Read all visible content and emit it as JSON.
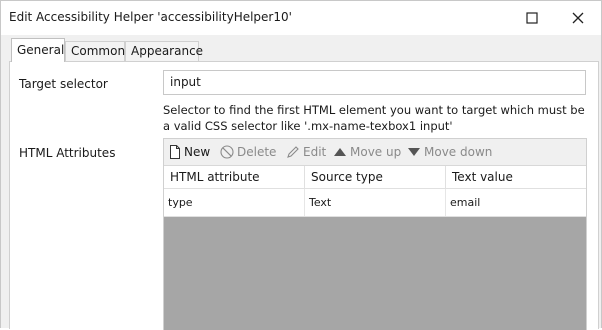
{
  "window": {
    "title": "Edit Accessibility Helper 'accessibilityHelper10'",
    "maximize_icon": "maximize-icon",
    "close_icon": "close-icon"
  },
  "tabs": [
    {
      "label": "General",
      "active": true
    },
    {
      "label": "Common",
      "active": false
    },
    {
      "label": "Appearance",
      "active": false
    }
  ],
  "form": {
    "target_selector_label": "Target selector",
    "target_selector_value": "input",
    "help_text": "Selector to find the first HTML element you want to target which must be a valid CSS selector like '.mx-name-texbox1 input'",
    "html_attributes_label": "HTML Attributes"
  },
  "toolbar": {
    "new_label": "New",
    "delete_label": "Delete",
    "edit_label": "Edit",
    "move_up_label": "Move up",
    "move_down_label": "Move down",
    "icons": [
      "new-document-icon",
      "delete-icon",
      "edit-pencil-icon",
      "move-up-icon",
      "move-down-icon"
    ]
  },
  "table": {
    "columns": [
      "HTML attribute",
      "Source type",
      "Text value"
    ],
    "rows": [
      [
        "type",
        "Text",
        "email"
      ]
    ]
  },
  "colors": {
    "empty_grid_area": "#a6a6a6",
    "disabled_text": "#8a8a8a"
  }
}
